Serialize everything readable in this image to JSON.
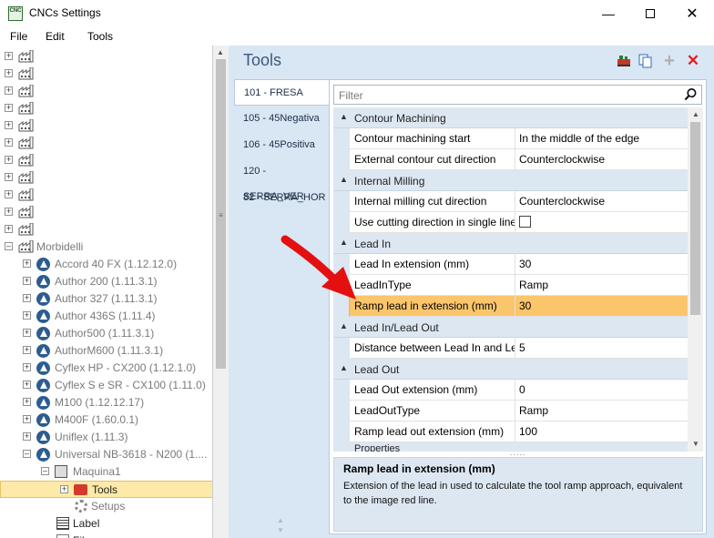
{
  "window": {
    "title": "CNCs Settings",
    "icon_text": "CNC"
  },
  "menu": [
    "File",
    "Edit",
    "Tools"
  ],
  "tree": {
    "group_label": "Morbidelli",
    "machines": [
      "Accord 40 FX (1.12.12.0)",
      "Author 200 (1.11.3.1)",
      "Author 327 (1.11.3.1)",
      "Author 436S (1.11.4)",
      "Author500 (1.11.3.1)",
      "AuthorM600 (1.11.3.1)",
      "Cyflex HP - CX200 (1.12.1.0)",
      "Cyflex S e SR - CX100 (1.11.0)",
      "M100 (1.12.12.17)",
      "M400F (1.60.0.1)",
      "Uniflex (1.11.3)",
      "Universal NB-3618 - N200 (1...."
    ],
    "machine_node": "Maquina1",
    "tools_node": "Tools",
    "setups_node": "Setups",
    "label_node": "Label",
    "file_node": "File"
  },
  "tools_panel": {
    "title": "Tools",
    "tool_list": [
      "101 - FRESA",
      "105 - 45Negativa",
      "106 - 45Positiva",
      "120 - SERRA_VER",
      "82 - SERRA_HOR"
    ],
    "filter_placeholder": "Filter"
  },
  "property_grid": {
    "categories": [
      {
        "name": "Contour Machining",
        "rows": [
          {
            "name": "Contour machining start",
            "value": "In the middle of the edge"
          },
          {
            "name": "External contour cut direction",
            "value": "Counterclockwise"
          }
        ]
      },
      {
        "name": "Internal Milling",
        "rows": [
          {
            "name": "Internal milling cut direction",
            "value": "Counterclockwise"
          },
          {
            "name": "Use cutting direction in single line...",
            "value": "",
            "checkbox": true,
            "checked": false
          }
        ]
      },
      {
        "name": "Lead In",
        "rows": [
          {
            "name": "Lead In extension (mm)",
            "value": "30"
          },
          {
            "name": "LeadInType",
            "value": "Ramp"
          },
          {
            "name": "Ramp lead in extension (mm)",
            "value": "30",
            "selected": true
          }
        ]
      },
      {
        "name": "Lead In/Lead Out",
        "rows": [
          {
            "name": "Distance between Lead In and Lea...",
            "value": "5"
          }
        ]
      },
      {
        "name": "Lead Out",
        "rows": [
          {
            "name": "Lead Out extension (mm)",
            "value": "0"
          },
          {
            "name": "LeadOutType",
            "value": "Ramp"
          },
          {
            "name": "Ramp lead out extension (mm)",
            "value": "100"
          }
        ]
      }
    ],
    "partial_category": "Properties",
    "description": {
      "title": "Ramp lead in extension (mm)",
      "text": "Extension of the lead in used to calculate the tool ramp approach, equivalent to the image red line."
    }
  },
  "colors": {
    "panel_bg": "#d9e6f4",
    "category_bg": "#dde7f2",
    "selected_row": "#fbc56b",
    "tree_selected": "#fde9a8",
    "arrow_red": "#e41010"
  }
}
